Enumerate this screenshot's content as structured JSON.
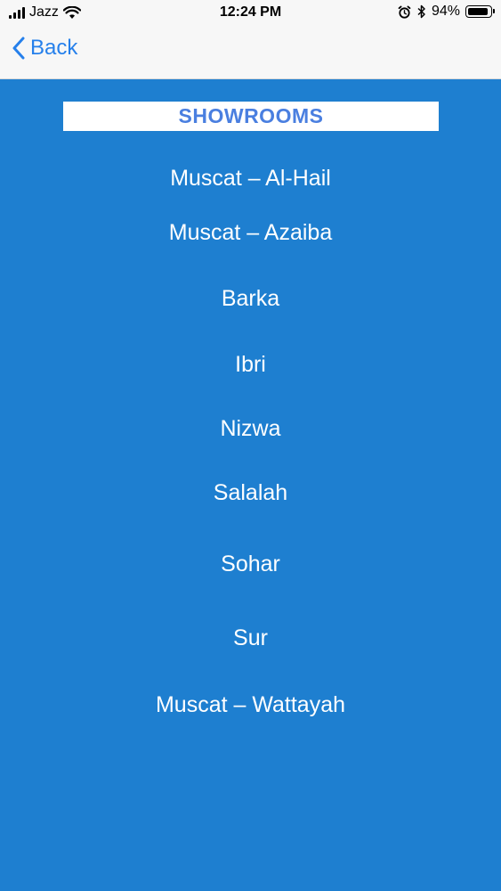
{
  "status_bar": {
    "carrier": "Jazz",
    "time": "12:24 PM",
    "battery_percent": "94%",
    "battery_level": 0.94
  },
  "nav": {
    "back_label": "Back"
  },
  "header": {
    "title": "SHOWROOMS"
  },
  "showrooms": [
    "Muscat – Al-Hail",
    "Muscat – Azaiba",
    "Barka",
    "Ibri",
    "Nizwa",
    "Salalah",
    "Sohar",
    "Sur",
    "Muscat – Wattayah"
  ],
  "colors": {
    "background": "#1e7fd0",
    "accent": "#2680eb",
    "header_text": "#4a7fe0",
    "item_text": "#ffffff"
  },
  "icons": {
    "signal": "cellular-signal-icon",
    "wifi": "wifi-icon",
    "alarm": "alarm-clock-icon",
    "bluetooth": "bluetooth-icon",
    "battery": "battery-icon",
    "back": "chevron-left-icon"
  }
}
